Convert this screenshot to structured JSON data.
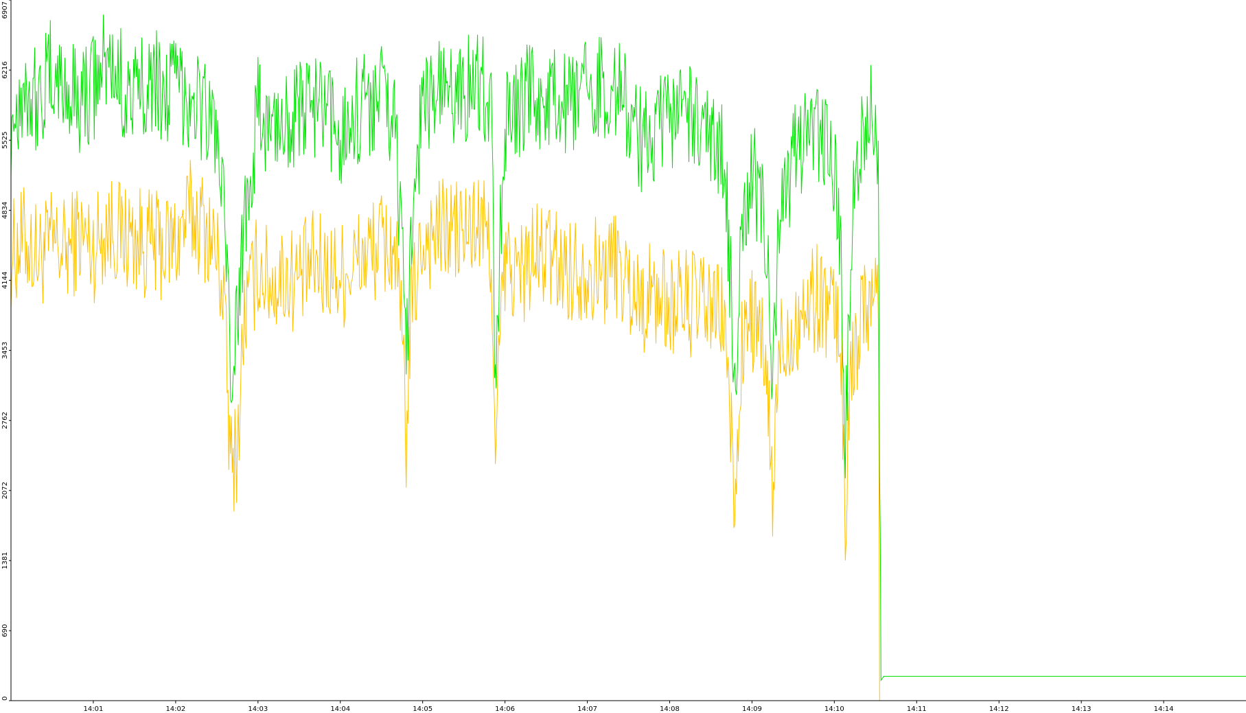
{
  "chart_data": {
    "type": "line",
    "title": "",
    "xlabel": "",
    "ylabel": "",
    "grid": false,
    "legend": "none",
    "ylim": [
      0,
      6907
    ],
    "xlim": [
      "14:00",
      "14:15"
    ],
    "y_ticks": [
      "0",
      "690",
      "1381",
      "2072",
      "2762",
      "3453",
      "4144",
      "4834",
      "5525",
      "6216",
      "6907"
    ],
    "x_ticks": [
      "14:01",
      "14:02",
      "14:03",
      "14:04",
      "14:05",
      "14:06",
      "14:07",
      "14:08",
      "14:09",
      "14:10",
      "14:11",
      "14:12",
      "14:13",
      "14:14"
    ],
    "series": [
      {
        "color": "#ffc000",
        "points": [
          [
            "14:00:00",
            4400
          ],
          [
            "14:00:10",
            4550
          ],
          [
            "14:00:20",
            4380
          ],
          [
            "14:00:30",
            4500
          ],
          [
            "14:00:40",
            4420
          ],
          [
            "14:00:50",
            4600
          ],
          [
            "14:01:00",
            4450
          ],
          [
            "14:01:10",
            4700
          ],
          [
            "14:01:20",
            4600
          ],
          [
            "14:01:30",
            4550
          ],
          [
            "14:01:40",
            4500
          ],
          [
            "14:01:50",
            4480
          ],
          [
            "14:02:00",
            4520
          ],
          [
            "14:02:10",
            4800
          ],
          [
            "14:02:20",
            4700
          ],
          [
            "14:02:30",
            4400
          ],
          [
            "14:02:35",
            4000
          ],
          [
            "14:02:40",
            2300
          ],
          [
            "14:02:45",
            2500
          ],
          [
            "14:02:50",
            3800
          ],
          [
            "14:03:00",
            4300
          ],
          [
            "14:03:10",
            4100
          ],
          [
            "14:03:20",
            4200
          ],
          [
            "14:03:30",
            4150
          ],
          [
            "14:03:40",
            4300
          ],
          [
            "14:03:50",
            4250
          ],
          [
            "14:04:00",
            4200
          ],
          [
            "14:04:10",
            4300
          ],
          [
            "14:04:20",
            4400
          ],
          [
            "14:04:30",
            4500
          ],
          [
            "14:04:40",
            4450
          ],
          [
            "14:04:45",
            3500
          ],
          [
            "14:04:48",
            2600
          ],
          [
            "14:04:52",
            3900
          ],
          [
            "14:05:00",
            4550
          ],
          [
            "14:05:10",
            4600
          ],
          [
            "14:05:20",
            4650
          ],
          [
            "14:05:30",
            4600
          ],
          [
            "14:05:40",
            4700
          ],
          [
            "14:05:50",
            4500
          ],
          [
            "14:05:53",
            2200
          ],
          [
            "14:05:56",
            3500
          ],
          [
            "14:06:00",
            4300
          ],
          [
            "14:06:10",
            4200
          ],
          [
            "14:06:20",
            4350
          ],
          [
            "14:06:30",
            4400
          ],
          [
            "14:06:40",
            4300
          ],
          [
            "14:06:50",
            4250
          ],
          [
            "14:07:00",
            4300
          ],
          [
            "14:07:10",
            4200
          ],
          [
            "14:07:20",
            4350
          ],
          [
            "14:07:30",
            4100
          ],
          [
            "14:07:40",
            3950
          ],
          [
            "14:07:50",
            4000
          ],
          [
            "14:08:00",
            3900
          ],
          [
            "14:08:10",
            3950
          ],
          [
            "14:08:20",
            3900
          ],
          [
            "14:08:30",
            3850
          ],
          [
            "14:08:40",
            3800
          ],
          [
            "14:08:45",
            2500
          ],
          [
            "14:08:48",
            1900
          ],
          [
            "14:08:52",
            3400
          ],
          [
            "14:09:00",
            3800
          ],
          [
            "14:09:10",
            3300
          ],
          [
            "14:09:15",
            2000
          ],
          [
            "14:09:20",
            3500
          ],
          [
            "14:09:30",
            3700
          ],
          [
            "14:09:40",
            3900
          ],
          [
            "14:09:50",
            4000
          ],
          [
            "14:10:00",
            3800
          ],
          [
            "14:10:05",
            3500
          ],
          [
            "14:10:08",
            1800
          ],
          [
            "14:10:12",
            3200
          ],
          [
            "14:10:20",
            3900
          ],
          [
            "14:10:30",
            4100
          ],
          [
            "14:10:32",
            4000
          ],
          [
            "14:10:33",
            0
          ],
          [
            "14:10:34",
            0
          ]
        ]
      },
      {
        "color": "#00e000",
        "points": [
          [
            "14:00:00",
            5700
          ],
          [
            "14:00:10",
            6100
          ],
          [
            "14:00:20",
            5900
          ],
          [
            "14:00:30",
            6200
          ],
          [
            "14:00:40",
            6000
          ],
          [
            "14:00:50",
            5950
          ],
          [
            "14:01:00",
            6050
          ],
          [
            "14:01:10",
            6300
          ],
          [
            "14:01:20",
            6100
          ],
          [
            "14:01:30",
            5900
          ],
          [
            "14:01:40",
            6200
          ],
          [
            "14:01:50",
            6000
          ],
          [
            "14:02:00",
            6050
          ],
          [
            "14:02:10",
            6000
          ],
          [
            "14:02:20",
            5850
          ],
          [
            "14:02:30",
            5600
          ],
          [
            "14:02:35",
            4800
          ],
          [
            "14:02:40",
            3200
          ],
          [
            "14:02:45",
            3700
          ],
          [
            "14:02:50",
            4800
          ],
          [
            "14:03:00",
            5800
          ],
          [
            "14:03:10",
            5600
          ],
          [
            "14:03:20",
            5800
          ],
          [
            "14:03:30",
            5750
          ],
          [
            "14:03:40",
            5900
          ],
          [
            "14:03:50",
            5700
          ],
          [
            "14:04:00",
            5600
          ],
          [
            "14:04:10",
            5800
          ],
          [
            "14:04:20",
            5900
          ],
          [
            "14:04:30",
            6000
          ],
          [
            "14:04:40",
            5700
          ],
          [
            "14:04:45",
            4300
          ],
          [
            "14:04:48",
            3400
          ],
          [
            "14:04:52",
            4800
          ],
          [
            "14:05:00",
            5900
          ],
          [
            "14:05:10",
            6000
          ],
          [
            "14:05:20",
            5950
          ],
          [
            "14:05:30",
            6050
          ],
          [
            "14:05:40",
            6100
          ],
          [
            "14:05:50",
            5900
          ],
          [
            "14:05:53",
            3000
          ],
          [
            "14:05:56",
            4400
          ],
          [
            "14:06:00",
            5700
          ],
          [
            "14:06:10",
            5800
          ],
          [
            "14:06:20",
            6000
          ],
          [
            "14:06:30",
            5850
          ],
          [
            "14:06:40",
            5900
          ],
          [
            "14:06:50",
            5800
          ],
          [
            "14:07:00",
            6000
          ],
          [
            "14:07:10",
            6100
          ],
          [
            "14:07:20",
            6050
          ],
          [
            "14:07:30",
            5800
          ],
          [
            "14:07:40",
            5500
          ],
          [
            "14:07:50",
            5600
          ],
          [
            "14:08:00",
            5700
          ],
          [
            "14:08:10",
            5900
          ],
          [
            "14:08:20",
            5600
          ],
          [
            "14:08:30",
            5500
          ],
          [
            "14:08:40",
            5400
          ],
          [
            "14:08:45",
            3900
          ],
          [
            "14:08:48",
            3100
          ],
          [
            "14:08:52",
            4700
          ],
          [
            "14:09:00",
            5200
          ],
          [
            "14:09:10",
            4700
          ],
          [
            "14:09:15",
            3200
          ],
          [
            "14:09:20",
            4700
          ],
          [
            "14:09:30",
            5300
          ],
          [
            "14:09:40",
            5500
          ],
          [
            "14:09:50",
            5600
          ],
          [
            "14:10:00",
            5300
          ],
          [
            "14:10:05",
            4400
          ],
          [
            "14:10:08",
            2500
          ],
          [
            "14:10:12",
            4500
          ],
          [
            "14:10:20",
            5600
          ],
          [
            "14:10:30",
            5800
          ],
          [
            "14:10:32",
            5500
          ],
          [
            "14:10:33",
            2300
          ],
          [
            "14:10:34",
            200
          ],
          [
            "14:10:36",
            240
          ],
          [
            "14:15:00",
            240
          ]
        ]
      }
    ]
  }
}
